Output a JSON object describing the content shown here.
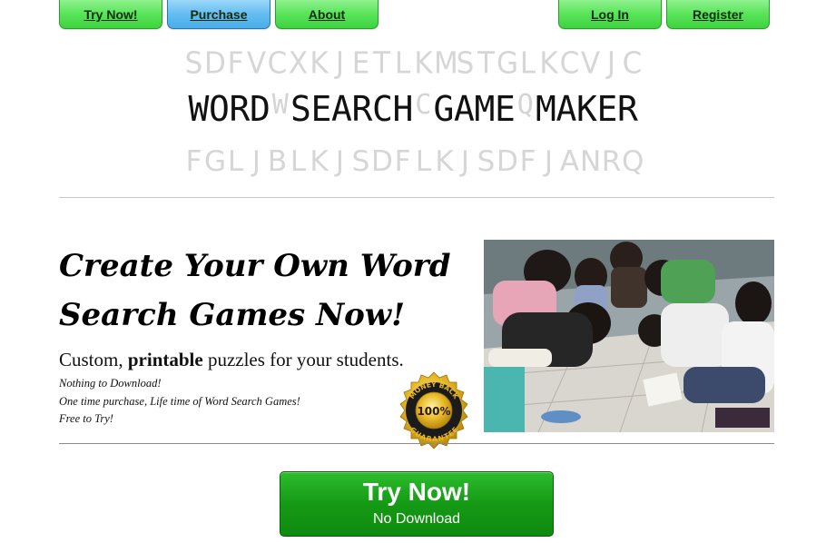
{
  "nav": {
    "try_now": "Try Now!",
    "purchase": "Purchase",
    "about": "About",
    "log_in": "Log In",
    "register": "Register"
  },
  "logo": {
    "top_row": "SDFVCXKJETLKMSTGLKCVJC",
    "main_row": [
      "W",
      "O",
      "R",
      "D",
      "W",
      "S",
      "E",
      "A",
      "R",
      "C",
      "H",
      "C",
      "G",
      "A",
      "M",
      "E",
      "Q",
      "M",
      "A",
      "K",
      "E",
      "R"
    ],
    "filler_positions": [
      4,
      11,
      16
    ],
    "bottom_row": "FGLJBLKJSDFLKJSDFJANRQ"
  },
  "hero": {
    "headline_line1": "Create Your Own Word",
    "headline_line2": "Search Games Now!",
    "sub_prefix": "Custom, ",
    "sub_bold": "printable",
    "sub_suffix": " puzzles for your students.",
    "bullets": [
      "Nothing to Download!",
      "One time purchase, Life time of Word Search Games!",
      "Free to Try!"
    ]
  },
  "badge": {
    "top": "MONEY BACK",
    "center": "100%",
    "bottom": "GUARANTEE"
  },
  "cta": {
    "title": "Try Now!",
    "subtitle": "No Download"
  },
  "colors": {
    "nav_green": "#57e457",
    "nav_blue": "#62bdf1",
    "cta_green": "#159a15",
    "badge_gold": "#e2b21f"
  }
}
